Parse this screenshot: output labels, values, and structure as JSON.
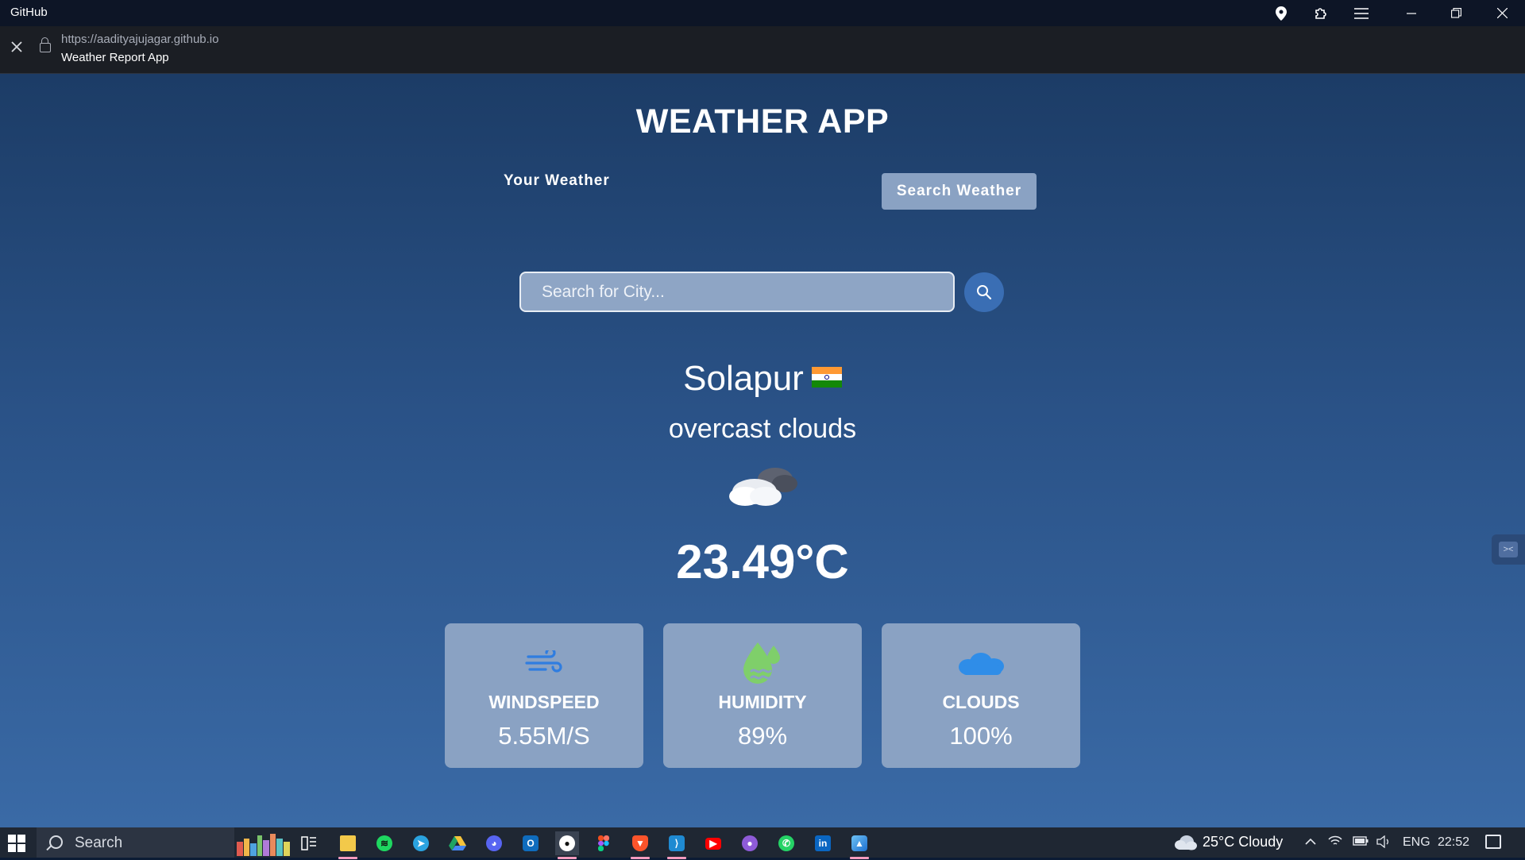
{
  "window": {
    "title": "GitHub"
  },
  "browser": {
    "url": "https://aadityajujagar.github.io",
    "page_title": "Weather Report App",
    "icons": [
      "location-icon",
      "extensions-icon",
      "menu-icon",
      "minimize-icon",
      "restore-icon",
      "close-icon"
    ]
  },
  "app": {
    "heading": "WEATHER APP",
    "tabs": {
      "your_weather": "Your Weather",
      "search_weather": "Search Weather"
    },
    "search": {
      "placeholder": "Search for City..."
    },
    "weather": {
      "city": "Solapur",
      "description": "overcast clouds",
      "temperature": "23.49°C"
    },
    "stats": [
      {
        "label": "WINDSPEED",
        "value": "5.55M/S",
        "icon": "wind-icon"
      },
      {
        "label": "HUMIDITY",
        "value": "89%",
        "icon": "humidity-icon"
      },
      {
        "label": "CLOUDS",
        "value": "100%",
        "icon": "cloud-icon"
      }
    ]
  },
  "taskbar": {
    "search_label": "Search",
    "weather": "25°C  Cloudy",
    "language": "ENG",
    "time": "22:52",
    "apps": [
      "task-view",
      "file-explorer",
      "spotify",
      "telegram",
      "google-drive",
      "discord",
      "outlook",
      "github",
      "figma",
      "brave",
      "vscode",
      "youtube",
      "github-desktop",
      "whatsapp",
      "linkedin",
      "photos"
    ]
  },
  "colors": {
    "accent": "#3a6eb4",
    "card": "#8aa2c3",
    "titlebar": "#0d1526"
  }
}
